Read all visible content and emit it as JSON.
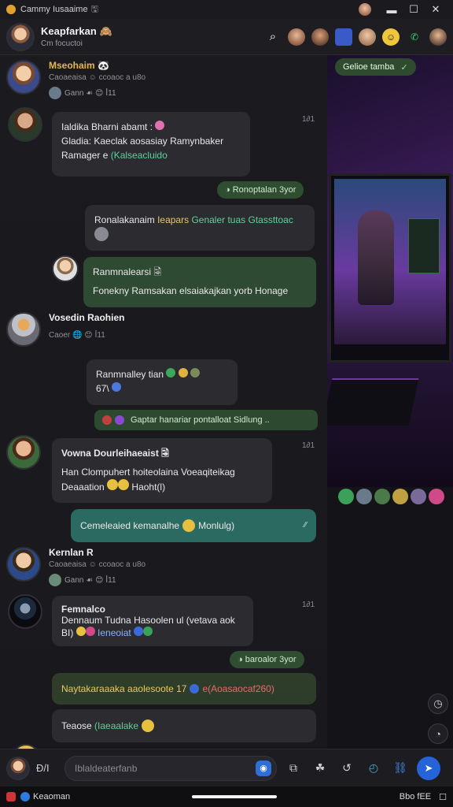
{
  "titlebar": {
    "title": "Cammy Iusaaime",
    "pin": "🖫",
    "minimize": "▬",
    "maximize": "☐",
    "close": "✕"
  },
  "header": {
    "title": "Keapfarkan",
    "title_emoji": "🙈",
    "subtitle": "Cm focuctoi"
  },
  "chat": {
    "s1": {
      "name": "Mseohaim 🐼",
      "meta": "Caoaeaisa  ☺  ccoaoc a u8o",
      "reacts": "Gann  ☙  😊  ꟾ11"
    },
    "m1": {
      "line1": "Ialdika Bharni abamt :",
      "line2": "Gladia: Kaeclak aosasiay Ramynbaker",
      "line3a": "Ramager e",
      "line3b": "(Kalseacluido",
      "time": "1∂1"
    },
    "pill1": "◑ Ronoptalan  3yor",
    "m2": {
      "text_a": "Ronalakanaim",
      "text_b": "Ieapars",
      "text_c": "Genaler tuas",
      "text_d": "Gtassttoac"
    },
    "m3": {
      "title": "Ranmnalearsi  🗟",
      "text": "Fonekny Ramsakan elsaiakajkan yorb Honage"
    },
    "s2": {
      "name": "Vosedin Raohien",
      "meta": "Caoer  🌐  😊  ꟾ11"
    },
    "m4": {
      "line1": "Ranmnalley tian",
      "line2": "67\\",
      "time": ""
    },
    "pill2": "Gaptar hanariar pontalloat Sidlung  ..",
    "s3": {
      "name": "Vowna Dourleihaeaist  🗟",
      "time": "1∂1"
    },
    "m5": {
      "line1": "Han Clompuhert hoiteolaina Voeaqiteikag",
      "line2a": "Deaaation",
      "line2b": "Haoht(l)"
    },
    "m6": {
      "text": "Cemeleaied kemanalhe",
      "text_b": "Monlulg)"
    },
    "s4": {
      "name": "Kernlan R",
      "meta": "Caoaeaisa  ☺  ccoaoc a u8o",
      "reacts": "Gann  ☙  😊  ꟾ11"
    },
    "m7": {
      "title": "Femnalco",
      "line1": "Dennaum Tudna Hasoolen ul (vetava aok",
      "line2": "BI)",
      "line2b": "Ieneoiat",
      "time": "1∂1"
    },
    "pill3": "◑ baroalor  3yor",
    "m8": {
      "line1a": "Naytakaraaaka aaolesoote 17",
      "line1b": "e(Aoasaocaf260)",
      "line2a": "Teaose",
      "line2b": "(Iaeaalake"
    }
  },
  "media": {
    "tag": "Gelioe tamba",
    "check": "✓"
  },
  "composer": {
    "gif": "Ð/I",
    "placeholder": "Iblaldeaterfanb"
  },
  "statusbar": {
    "left": "Keaoman",
    "right1": "Bbo fEE",
    "right2": "☐"
  }
}
